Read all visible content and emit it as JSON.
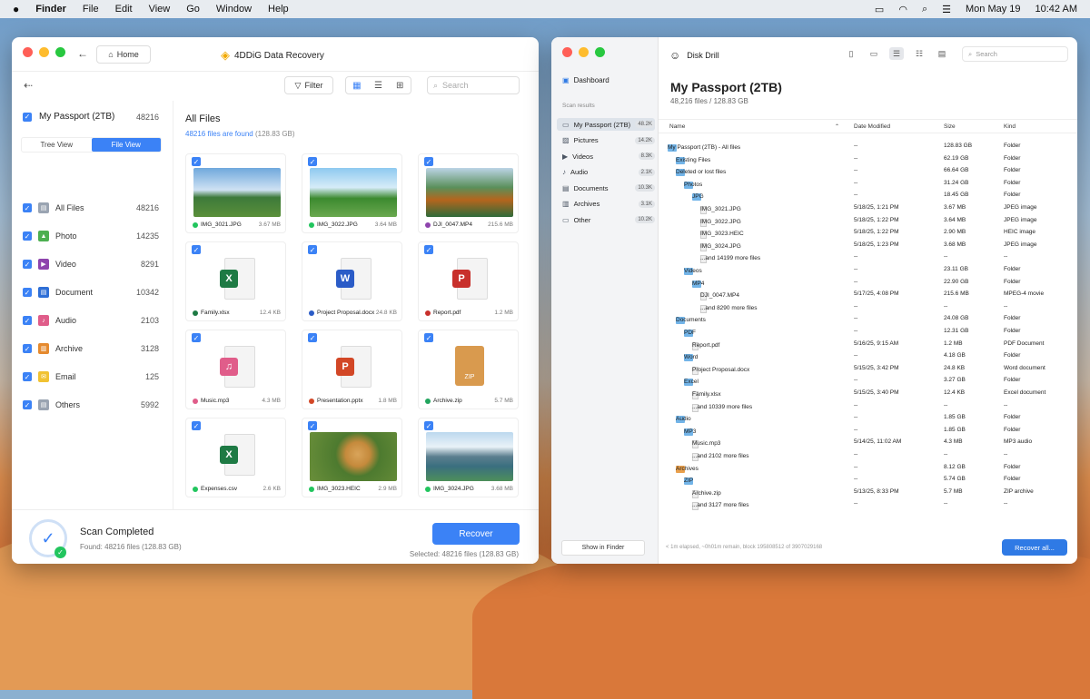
{
  "menubar": {
    "app": "Finder",
    "items": [
      "File",
      "Edit",
      "View",
      "Go",
      "Window",
      "Help"
    ],
    "datetime": "Mon May 19",
    "time": "10:42 AM"
  },
  "left": {
    "home_label": "Home",
    "app_title": "4DDiG Data Recovery",
    "filter_label": "Filter",
    "search_placeholder": "Search",
    "drive": {
      "name": "My Passport (2TB)",
      "count": "48216"
    },
    "tabs": {
      "tree": "Tree View",
      "file": "File View"
    },
    "categories": [
      {
        "name": "All Files",
        "count": "48216",
        "color": "#9aa4b2"
      },
      {
        "name": "Photo",
        "count": "14235",
        "color": "#4caf50"
      },
      {
        "name": "Video",
        "count": "8291",
        "color": "#8e44ad"
      },
      {
        "name": "Document",
        "count": "10342",
        "color": "#2f6fd6"
      },
      {
        "name": "Audio",
        "count": "2103",
        "color": "#e05d8a"
      },
      {
        "name": "Archive",
        "count": "3128",
        "color": "#e58a2e"
      },
      {
        "name": "Email",
        "count": "125",
        "color": "#f1c232"
      },
      {
        "name": "Others",
        "count": "5992",
        "color": "#9aa4b2"
      }
    ],
    "heading": "All Files",
    "found_count": "48216 files are found",
    "found_size": "(128.83 GB)",
    "cards": [
      {
        "name": "IMG_3021.JPG",
        "size": "3.67 MB"
      },
      {
        "name": "IMG_3022.JPG",
        "size": "3.64 MB"
      },
      {
        "name": "DJI_0047.MP4",
        "size": "215.6 MB"
      },
      {
        "name": "Family.xlsx",
        "size": "12.4 KB"
      },
      {
        "name": "Project Proposal.docx",
        "size": "24.8 KB"
      },
      {
        "name": "Report.pdf",
        "size": "1.2 MB"
      },
      {
        "name": "Music.mp3",
        "size": "4.3 MB"
      },
      {
        "name": "Presentation.pptx",
        "size": "1.8 MB"
      },
      {
        "name": "Archive.zip",
        "size": "5.7 MB"
      },
      {
        "name": "Expenses.csv",
        "size": "2.6 KB"
      },
      {
        "name": "IMG_3023.HEIC",
        "size": "2.9 MB"
      },
      {
        "name": "IMG_3024.JPG",
        "size": "3.68 MB"
      }
    ],
    "scan_status": "Scan Completed",
    "scan_found": "Found: 48216 files (128.83 GB)",
    "recover_label": "Recover",
    "selected": "Selected: 48216 files (128.83 GB)"
  },
  "right": {
    "app_title": "Disk Drill",
    "search_placeholder": "Search",
    "dashboard": "Dashboard",
    "scan_results": "Scan results",
    "side_items": [
      {
        "name": "My Passport (2TB)",
        "count": "48.2K"
      },
      {
        "name": "Pictures",
        "count": "14.2K"
      },
      {
        "name": "Videos",
        "count": "8.3K"
      },
      {
        "name": "Audio",
        "count": "2.1K"
      },
      {
        "name": "Documents",
        "count": "10.3K"
      },
      {
        "name": "Archives",
        "count": "3.1K"
      },
      {
        "name": "Other",
        "count": "10.2K"
      }
    ],
    "show_in_finder": "Show in Finder",
    "title": "My Passport (2TB)",
    "subtitle": "48,216 files / 128.83 GB",
    "columns": {
      "name": "Name",
      "date": "Date Modified",
      "size": "Size",
      "kind": "Kind"
    },
    "rows": [
      {
        "name": "My Passport (2TB) - All files",
        "date": "--",
        "size": "128.83 GB",
        "kind": "Folder"
      },
      {
        "name": "Existing Files",
        "date": "--",
        "size": "62.19 GB",
        "kind": "Folder"
      },
      {
        "name": "Deleted or lost files",
        "date": "--",
        "size": "66.64 GB",
        "kind": "Folder"
      },
      {
        "name": "Photos",
        "date": "--",
        "size": "31.24 GB",
        "kind": "Folder"
      },
      {
        "name": "JPG",
        "date": "--",
        "size": "18.45 GB",
        "kind": "Folder"
      },
      {
        "name": "IMG_3021.JPG",
        "date": "5/18/25, 1:21 PM",
        "size": "3.67 MB",
        "kind": "JPEG image"
      },
      {
        "name": "IMG_3022.JPG",
        "date": "5/18/25, 1:22 PM",
        "size": "3.64 MB",
        "kind": "JPEG image"
      },
      {
        "name": "IMG_3023.HEIC",
        "date": "5/18/25, 1:22 PM",
        "size": "2.90 MB",
        "kind": "HEIC image"
      },
      {
        "name": "IMG_3024.JPG",
        "date": "5/18/25, 1:23 PM",
        "size": "3.68 MB",
        "kind": "JPEG image"
      },
      {
        "name": "...and 14199 more files",
        "date": "--",
        "size": "--",
        "kind": "--"
      },
      {
        "name": "Videos",
        "date": "--",
        "size": "23.11 GB",
        "kind": "Folder"
      },
      {
        "name": "MP4",
        "date": "--",
        "size": "22.90 GB",
        "kind": "Folder"
      },
      {
        "name": "DJI_0047.MP4",
        "date": "5/17/25, 4:08 PM",
        "size": "215.6 MB",
        "kind": "MPEG-4 movie"
      },
      {
        "name": "...and 8290 more files",
        "date": "--",
        "size": "--",
        "kind": "--"
      },
      {
        "name": "Documents",
        "date": "--",
        "size": "24.08 GB",
        "kind": "Folder"
      },
      {
        "name": "PDF",
        "date": "--",
        "size": "12.31 GB",
        "kind": "Folder"
      },
      {
        "name": "Report.pdf",
        "date": "5/16/25, 9:15 AM",
        "size": "1.2 MB",
        "kind": "PDF Document"
      },
      {
        "name": "Word",
        "date": "--",
        "size": "4.18 GB",
        "kind": "Folder"
      },
      {
        "name": "Project Proposal.docx",
        "date": "5/15/25, 3:42 PM",
        "size": "24.8 KB",
        "kind": "Word document"
      },
      {
        "name": "Excel",
        "date": "--",
        "size": "3.27 GB",
        "kind": "Folder"
      },
      {
        "name": "Family.xlsx",
        "date": "5/15/25, 3:40 PM",
        "size": "12.4 KB",
        "kind": "Excel document"
      },
      {
        "name": "...and 10339 more files",
        "date": "--",
        "size": "--",
        "kind": "--"
      },
      {
        "name": "Audio",
        "date": "--",
        "size": "1.85 GB",
        "kind": "Folder"
      },
      {
        "name": "MP3",
        "date": "--",
        "size": "1.85 GB",
        "kind": "Folder"
      },
      {
        "name": "Music.mp3",
        "date": "5/14/25, 11:02 AM",
        "size": "4.3 MB",
        "kind": "MP3 audio"
      },
      {
        "name": "...and 2102 more files",
        "date": "--",
        "size": "--",
        "kind": "--"
      },
      {
        "name": "Archives",
        "date": "--",
        "size": "8.12 GB",
        "kind": "Folder"
      },
      {
        "name": "ZIP",
        "date": "--",
        "size": "5.74 GB",
        "kind": "Folder"
      },
      {
        "name": "Archive.zip",
        "date": "5/13/25, 8:33 PM",
        "size": "5.7 MB",
        "kind": "ZIP archive"
      },
      {
        "name": "...and 3127 more files",
        "date": "--",
        "size": "--",
        "kind": "--"
      }
    ],
    "status": "< 1m elapsed, ~0h01m remain, block 195808512 of 3907029168",
    "recover_all": "Recover all..."
  }
}
